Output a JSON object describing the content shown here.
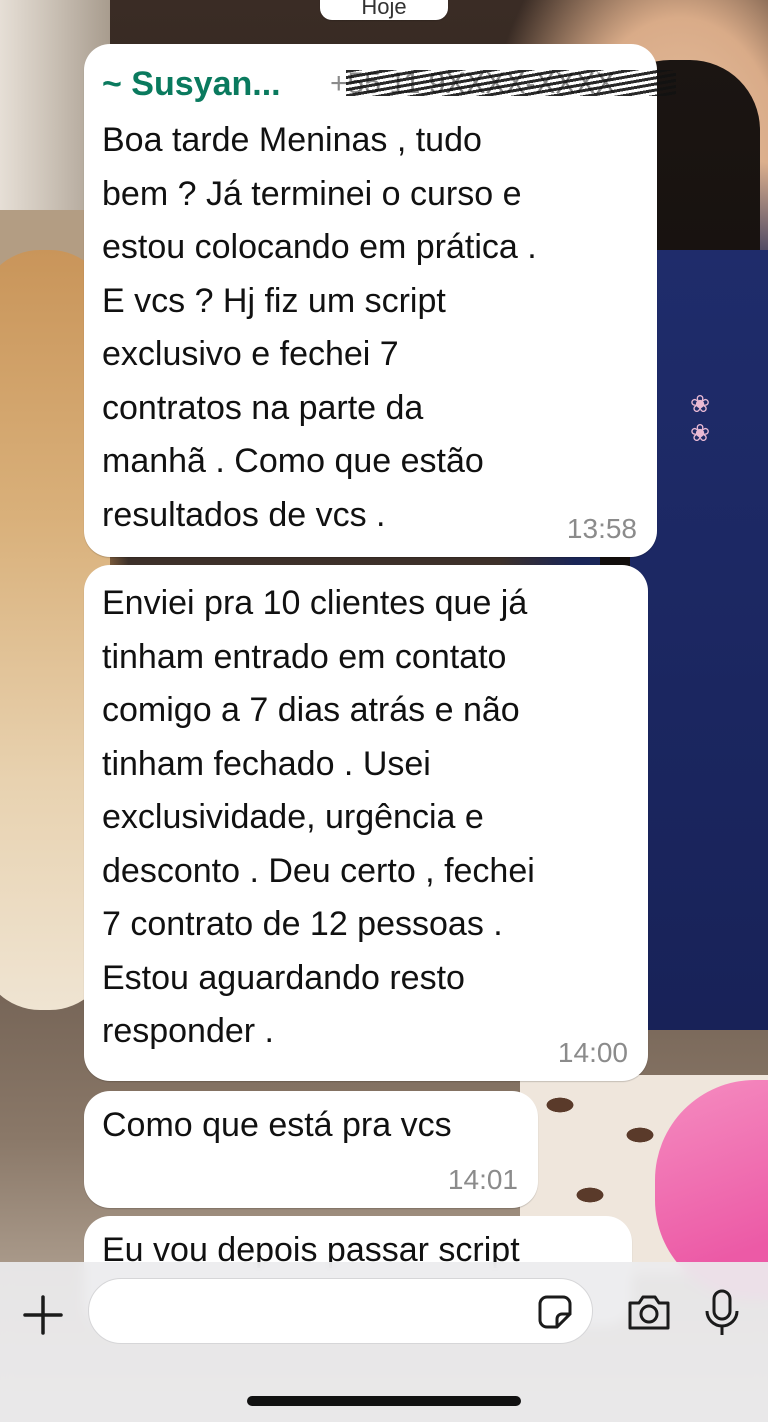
{
  "date_label": "Hoje",
  "messages": [
    {
      "sender": "~ Susyan...",
      "phone": "+55 11 9XXXX-XXXX",
      "text": "Boa tarde Meninas , tudo\nbem ? Já terminei  o curso e\nestou colocando em prática .\nE vcs ? Hj fiz um script\nexclusivo e fechei 7\ncontratos na parte da\nmanhã . Como que estão\nresultados de vcs .",
      "time": "13:58"
    },
    {
      "text": "Enviei pra 10 clientes que já\ntinham entrado em contato\ncomigo a 7 dias atrás e não\ntinham fechado . Usei\nexclusividade, urgência e\ndesconto . Deu certo , fechei\n7 contrato de 12 pessoas .\nEstou aguardando resto\nresponder .",
      "time": "14:00"
    },
    {
      "text": "Como que está pra vcs",
      "time": "14:01"
    },
    {
      "text": "Eu vou depois passar script"
    }
  ],
  "composer": {
    "input_value": "",
    "icons": [
      "plus-icon",
      "sticker-icon",
      "camera-icon",
      "microphone-icon"
    ]
  },
  "colors": {
    "sender": "#0a7a5e",
    "bubble": "#ffffff",
    "timestamp": "#8b8b8b"
  }
}
